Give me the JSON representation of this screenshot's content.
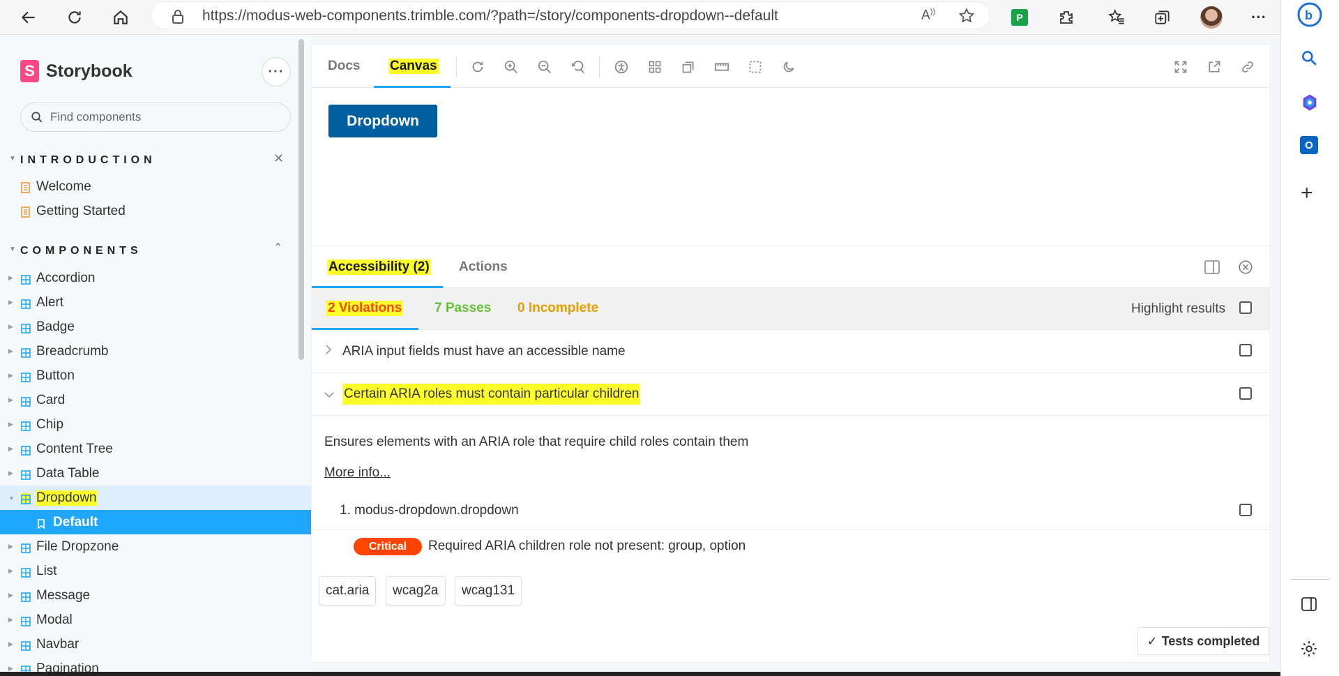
{
  "browser": {
    "url": "https://modus-web-components.trimble.com/?path=/story/components-dropdown--default"
  },
  "sidebar": {
    "brand": "Storybook",
    "search_placeholder": "Find components",
    "introduction": {
      "title": "INTRODUCTION",
      "items": [
        "Welcome",
        "Getting Started"
      ]
    },
    "components": {
      "title": "COMPONENTS",
      "items": [
        "Accordion",
        "Alert",
        "Badge",
        "Breadcrumb",
        "Button",
        "Card",
        "Chip",
        "Content Tree",
        "Data Table",
        "Dropdown",
        "File Dropzone",
        "List",
        "Message",
        "Modal",
        "Navbar",
        "Pagination"
      ],
      "selected_parent": "Dropdown",
      "selected_child": "Default"
    }
  },
  "toolbar": {
    "tab_docs": "Docs",
    "tab_canvas": "Canvas"
  },
  "canvas": {
    "dropdown_button": "Dropdown"
  },
  "addons": {
    "tab_accessibility": "Accessibility (2)",
    "tab_actions": "Actions",
    "violations": "2 Violations",
    "passes": "7 Passes",
    "incomplete": "0 Incomplete",
    "highlight_label": "Highlight results",
    "rules": [
      {
        "title": "ARIA input fields must have an accessible name",
        "expanded": false
      },
      {
        "title": "Certain ARIA roles must contain particular children",
        "expanded": true
      }
    ],
    "detail": {
      "description": "Ensures elements with an ARIA role that require child roles contain them",
      "more_info": "More info...",
      "node": "1. modus-dropdown.dropdown",
      "severity": "Critical",
      "message": "Required ARIA children role not present: group, option",
      "tags": [
        "cat.aria",
        "wcag2a",
        "wcag131"
      ]
    },
    "status": "Tests completed"
  },
  "colors": {
    "accent": "#1ea7fd",
    "violations": "#ff4400",
    "passes": "#66bf3c",
    "incomplete": "#e69d00",
    "highlight": "#ffff2a",
    "button": "#005f9e"
  }
}
